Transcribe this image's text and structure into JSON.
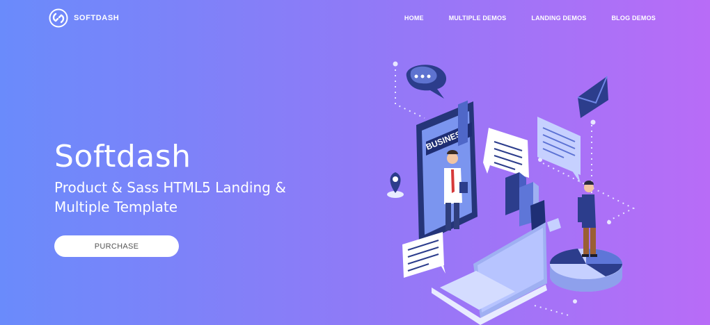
{
  "brand": {
    "name": "SOFTDASH",
    "logo_icon": "link-icon"
  },
  "nav": {
    "items": [
      {
        "label": "HOME"
      },
      {
        "label": "MULTIPLE DEMOS"
      },
      {
        "label": "LANDING DEMOS"
      },
      {
        "label": "BLOG DEMOS"
      }
    ]
  },
  "hero": {
    "title": "Softdash",
    "subtitle_line1": "Product & Sass HTML5 Landing &",
    "subtitle_line2": "Multiple Template",
    "cta_label": "PURCHASE"
  },
  "illustration": {
    "sign_text": "BUSINESS"
  },
  "colors": {
    "gradient_start": "#6a8bfb",
    "gradient_end": "#b86cf7",
    "accent_dark": "#2b3a86"
  }
}
